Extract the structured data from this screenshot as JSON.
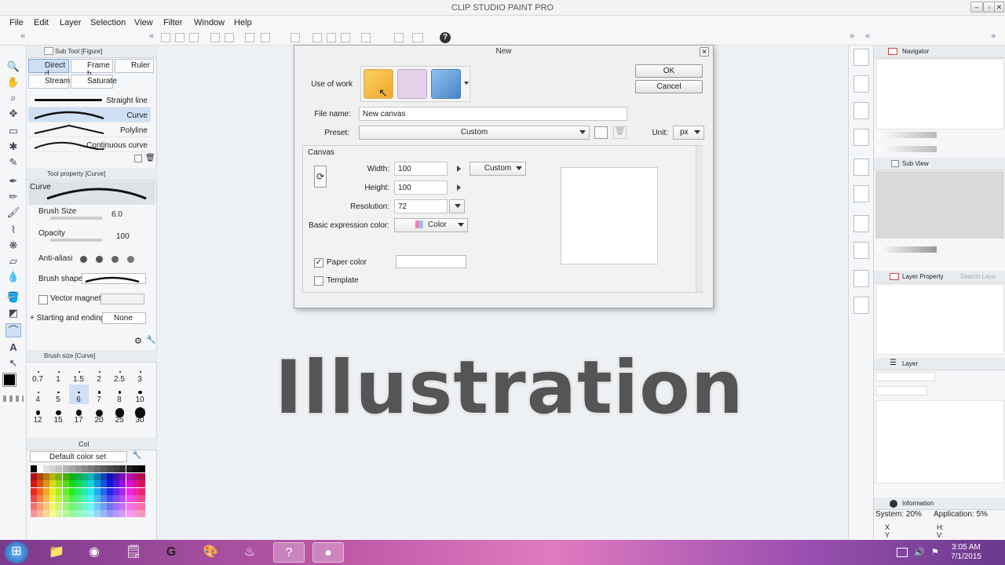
{
  "app": {
    "title": "CLIP STUDIO PAINT PRO"
  },
  "menu": [
    "File",
    "Edit",
    "Layer",
    "Selection",
    "View",
    "Filter",
    "Window",
    "Help"
  ],
  "sub_tool": {
    "header": "Sub Tool [Figure]",
    "tabs": [
      "Direct d",
      "Frame b",
      "Ruler",
      "Stream",
      "Saturate"
    ],
    "items": [
      "Straight line",
      "Curve",
      "Polyline",
      "Continuous curve"
    ],
    "selected": "Curve"
  },
  "tool_property": {
    "header": "Tool property [Curve]",
    "tool_name": "Curve",
    "brush_size_label": "Brush Size",
    "brush_size_value": "6.0",
    "opacity_label": "Opacity",
    "opacity_value": "100",
    "anti_alias_label": "Anti-aliasi",
    "brush_shape_label": "Brush shape",
    "vector_magnet_label": "Vector magnet",
    "starting_ending_label": "Starting and ending",
    "starting_ending_value": "None"
  },
  "brush_size_panel": {
    "header": "Brush size [Curve]",
    "sizes": [
      "0.7",
      "1",
      "1.5",
      "2",
      "2.5",
      "3",
      "4",
      "5",
      "6",
      "7",
      "8",
      "10",
      "12",
      "15",
      "17",
      "20",
      "25",
      "30"
    ],
    "selected": "6"
  },
  "color_set": {
    "tab": "Col",
    "name": "Default color set"
  },
  "right_panels": {
    "navigator": "Navigator",
    "sub_view": "Sub View",
    "layer_property": "Layer Property",
    "search_layer": "Search Laye",
    "layer": "Layer",
    "information": "Information",
    "system_usage": "System: 20%",
    "application_usage": "Application:   5%",
    "coord_x": "X",
    "coord_y": "Y",
    "coord_h": "H:",
    "coord_v": "V:"
  },
  "dialog": {
    "title": "New",
    "use_of_work_label": "Use of work",
    "ok_label": "OK",
    "cancel_label": "Cancel",
    "file_name_label": "File name:",
    "file_name_value": "New canvas",
    "preset_label": "Preset:",
    "preset_value": "Custom",
    "unit_label": "Unit:",
    "unit_value": "px",
    "canvas_group_label": "Canvas",
    "width_label": "Width:",
    "width_value": "100",
    "size_preset_value": "Custom",
    "height_label": "Height:",
    "height_value": "100",
    "resolution_label": "Resolution:",
    "resolution_value": "72",
    "basic_color_label": "Basic expression color:",
    "basic_color_value": "Color",
    "paper_color_label": "Paper color",
    "paper_color_checked": true,
    "template_label": "Template",
    "template_checked": false
  },
  "overlay_caption": "Illustration",
  "taskbar": {
    "time": "3:05 AM",
    "date": "7/1/2015"
  },
  "colors": {
    "selection_blue": "#cfe0f4",
    "caption_gray": "#555555",
    "taskbar_purple": "#9a4fb0"
  }
}
